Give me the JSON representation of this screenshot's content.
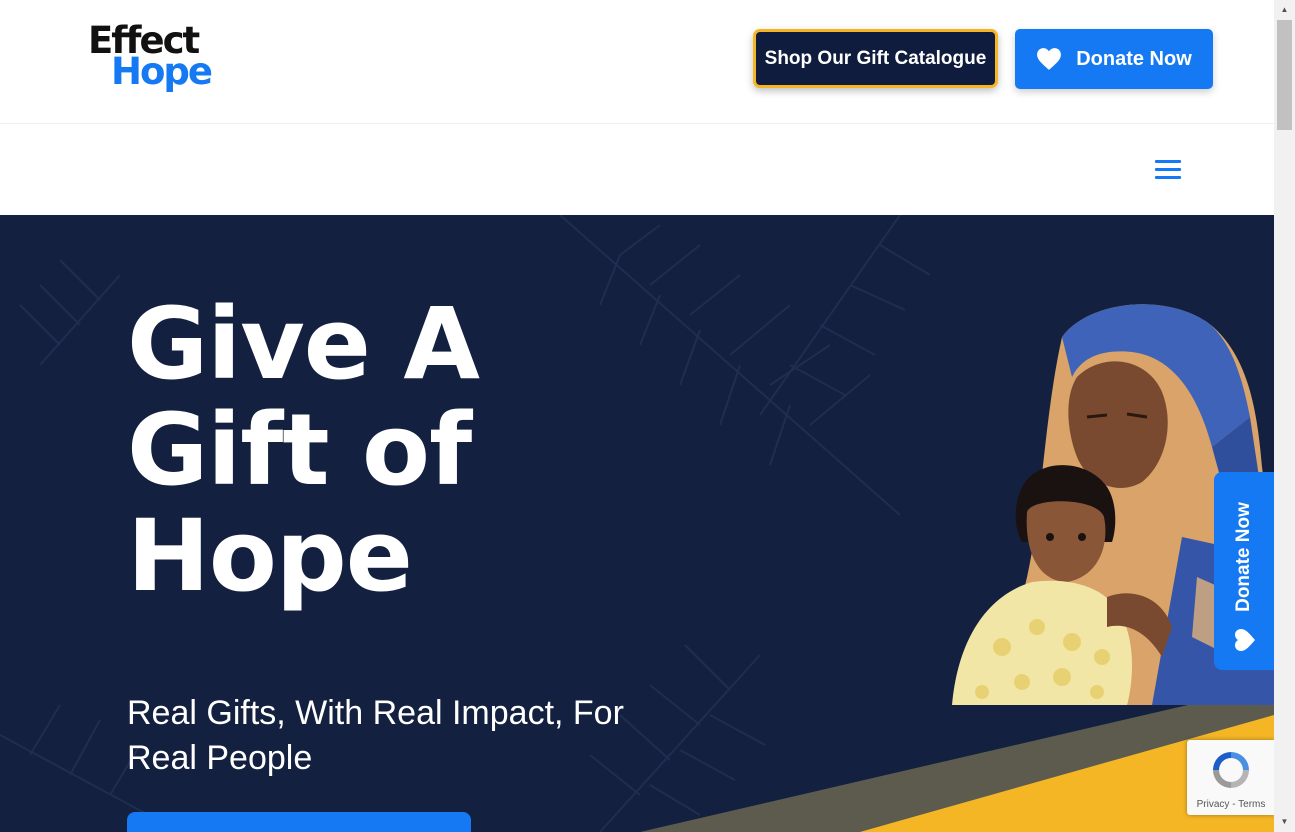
{
  "header": {
    "logo_line1": "Effect",
    "logo_line2": "Hope",
    "catalogue_button": "Shop Our Gift Catalogue",
    "donate_button": "Donate Now"
  },
  "nav": {
    "menu_icon": "hamburger-menu-icon"
  },
  "hero": {
    "title_line1": "Give A",
    "title_line2": "Gift of",
    "title_line3": "Hope",
    "subtitle": "Real Gifts, With Real Impact, For Real People",
    "photo_icon": "mother-and-child-photo"
  },
  "side_tab": {
    "label": "Donate Now",
    "icon": "heart-icon"
  },
  "recaptcha": {
    "privacy": "Privacy",
    "separator": "-",
    "terms": "Terms"
  },
  "colors": {
    "brand_blue": "#1479f2",
    "navy": "#13203f",
    "gold": "#f5b625",
    "logo_black": "#111111"
  }
}
